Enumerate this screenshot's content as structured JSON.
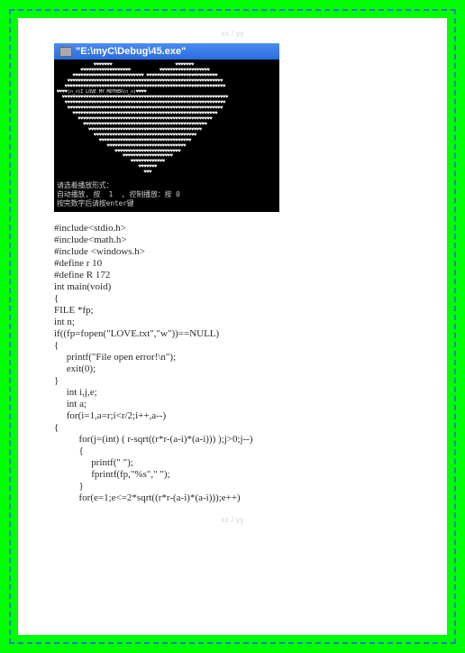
{
  "topPageNum": "xx / yy",
  "bottomPageNum": "xx / yy",
  "console": {
    "title": "\"E:\\myC\\Debug\\45.exe\"",
    "heartLines": [
      "              ♥♥♥♥♥♥♥                        ♥♥♥♥♥♥♥",
      "         ♥♥♥♥♥♥♥♥♥♥♥♥♥♥♥♥♥♥♥           ♥♥♥♥♥♥♥♥♥♥♥♥♥♥♥♥♥♥♥",
      "      ♥♥♥♥♥♥♥♥♥♥♥♥♥♥♥♥♥♥♥♥♥♥♥♥♥♥♥ ♥♥♥♥♥♥♥♥♥♥♥♥♥♥♥♥♥♥♥♥♥♥♥♥♥♥♥",
      "    ♥♥♥♥♥♥♥♥♥♥♥♥♥♥♥♥♥♥♥♥♥♥♥♥♥♥♥♥♥♥♥♥♥♥♥♥♥♥♥♥♥♥♥♥♥♥♥♥♥♥♥♥♥♥♥♥♥♥♥",
      "   ♥♥♥♥♥♥♥♥♥♥♥♥♥♥♥♥♥♥♥♥♥♥♥♥♥♥♥♥♥♥♥♥♥♥♥♥♥♥♥♥♥♥♥♥♥♥♥♥♥♥♥♥♥♥♥♥♥♥♥♥♥",
      "♥♥♥♥(∩_∩)I LOVE MY MOTHER(∩_∩)♥♥♥♥",
      "  ♥♥♥♥♥♥♥♥♥♥♥♥♥♥♥♥♥♥♥♥♥♥♥♥♥♥♥♥♥♥♥♥♥♥♥♥♥♥♥♥♥♥♥♥♥♥♥♥♥♥♥♥♥♥♥♥♥♥♥♥♥♥♥",
      "   ♥♥♥♥♥♥♥♥♥♥♥♥♥♥♥♥♥♥♥♥♥♥♥♥♥♥♥♥♥♥♥♥♥♥♥♥♥♥♥♥♥♥♥♥♥♥♥♥♥♥♥♥♥♥♥♥♥♥♥♥♥",
      "    ♥♥♥♥♥♥♥♥♥♥♥♥♥♥♥♥♥♥♥♥♥♥♥♥♥♥♥♥♥♥♥♥♥♥♥♥♥♥♥♥♥♥♥♥♥♥♥♥♥♥♥♥♥♥♥♥♥♥♥",
      "      ♥♥♥♥♥♥♥♥♥♥♥♥♥♥♥♥♥♥♥♥♥♥♥♥♥♥♥♥♥♥♥♥♥♥♥♥♥♥♥♥♥♥♥♥♥♥♥♥♥♥♥♥♥♥♥",
      "        ♥♥♥♥♥♥♥♥♥♥♥♥♥♥♥♥♥♥♥♥♥♥♥♥♥♥♥♥♥♥♥♥♥♥♥♥♥♥♥♥♥♥♥♥♥♥♥♥♥♥♥",
      "          ♥♥♥♥♥♥♥♥♥♥♥♥♥♥♥♥♥♥♥♥♥♥♥♥♥♥♥♥♥♥♥♥♥♥♥♥♥♥♥♥♥♥♥♥♥♥♥",
      "            ♥♥♥♥♥♥♥♥♥♥♥♥♥♥♥♥♥♥♥♥♥♥♥♥♥♥♥♥♥♥♥♥♥♥♥♥♥♥♥♥♥♥♥",
      "              ♥♥♥♥♥♥♥♥♥♥♥♥♥♥♥♥♥♥♥♥♥♥♥♥♥♥♥♥♥♥♥♥♥♥♥♥♥♥♥",
      "                ♥♥♥♥♥♥♥♥♥♥♥♥♥♥♥♥♥♥♥♥♥♥♥♥♥♥♥♥♥♥♥♥♥♥♥",
      "                   ♥♥♥♥♥♥♥♥♥♥♥♥♥♥♥♥♥♥♥♥♥♥♥♥♥♥♥♥♥♥",
      "                      ♥♥♥♥♥♥♥♥♥♥♥♥♥♥♥♥♥♥♥♥♥♥♥♥♥",
      "                         ♥♥♥♥♥♥♥♥♥♥♥♥♥♥♥♥♥♥♥",
      "                            ♥♥♥♥♥♥♥♥♥♥♥♥♥",
      "                               ♥♥♥♥♥♥♥",
      "                                 ♥♥♥"
    ],
    "promptLines": [
      "请选着播放形式：",
      "自动播放, 按  1  , 控制播放：按 0",
      "按完数字后请按enter键"
    ]
  },
  "codeLines": [
    "#include<stdio.h>",
    "#include<math.h>",
    "#include <windows.h>",
    "#define r 10",
    "#define R 172",
    "int main(void)",
    "{",
    "FILE *fp;",
    "int n;",
    "if((fp=fopen(\"LOVE.txt\",\"w\"))==NULL)",
    "{",
    "     printf(\"File open error!\\n\");",
    "     exit(0);",
    "}",
    "     int i,j,e;",
    "     int a;",
    "     for(i=1,a=r;i<r/2;i++,a--)",
    "{",
    "          for(j=(int) ( r-sqrt((r*r-(a-i)*(a-i))) );j>0;j--)",
    "          {",
    "               printf(\" \");",
    "               fprintf(fp,\"%s\",\" \");",
    "          }",
    "          for(e=1;e<=2*sqrt((r*r-(a-i)*(a-i)));e++)"
  ]
}
